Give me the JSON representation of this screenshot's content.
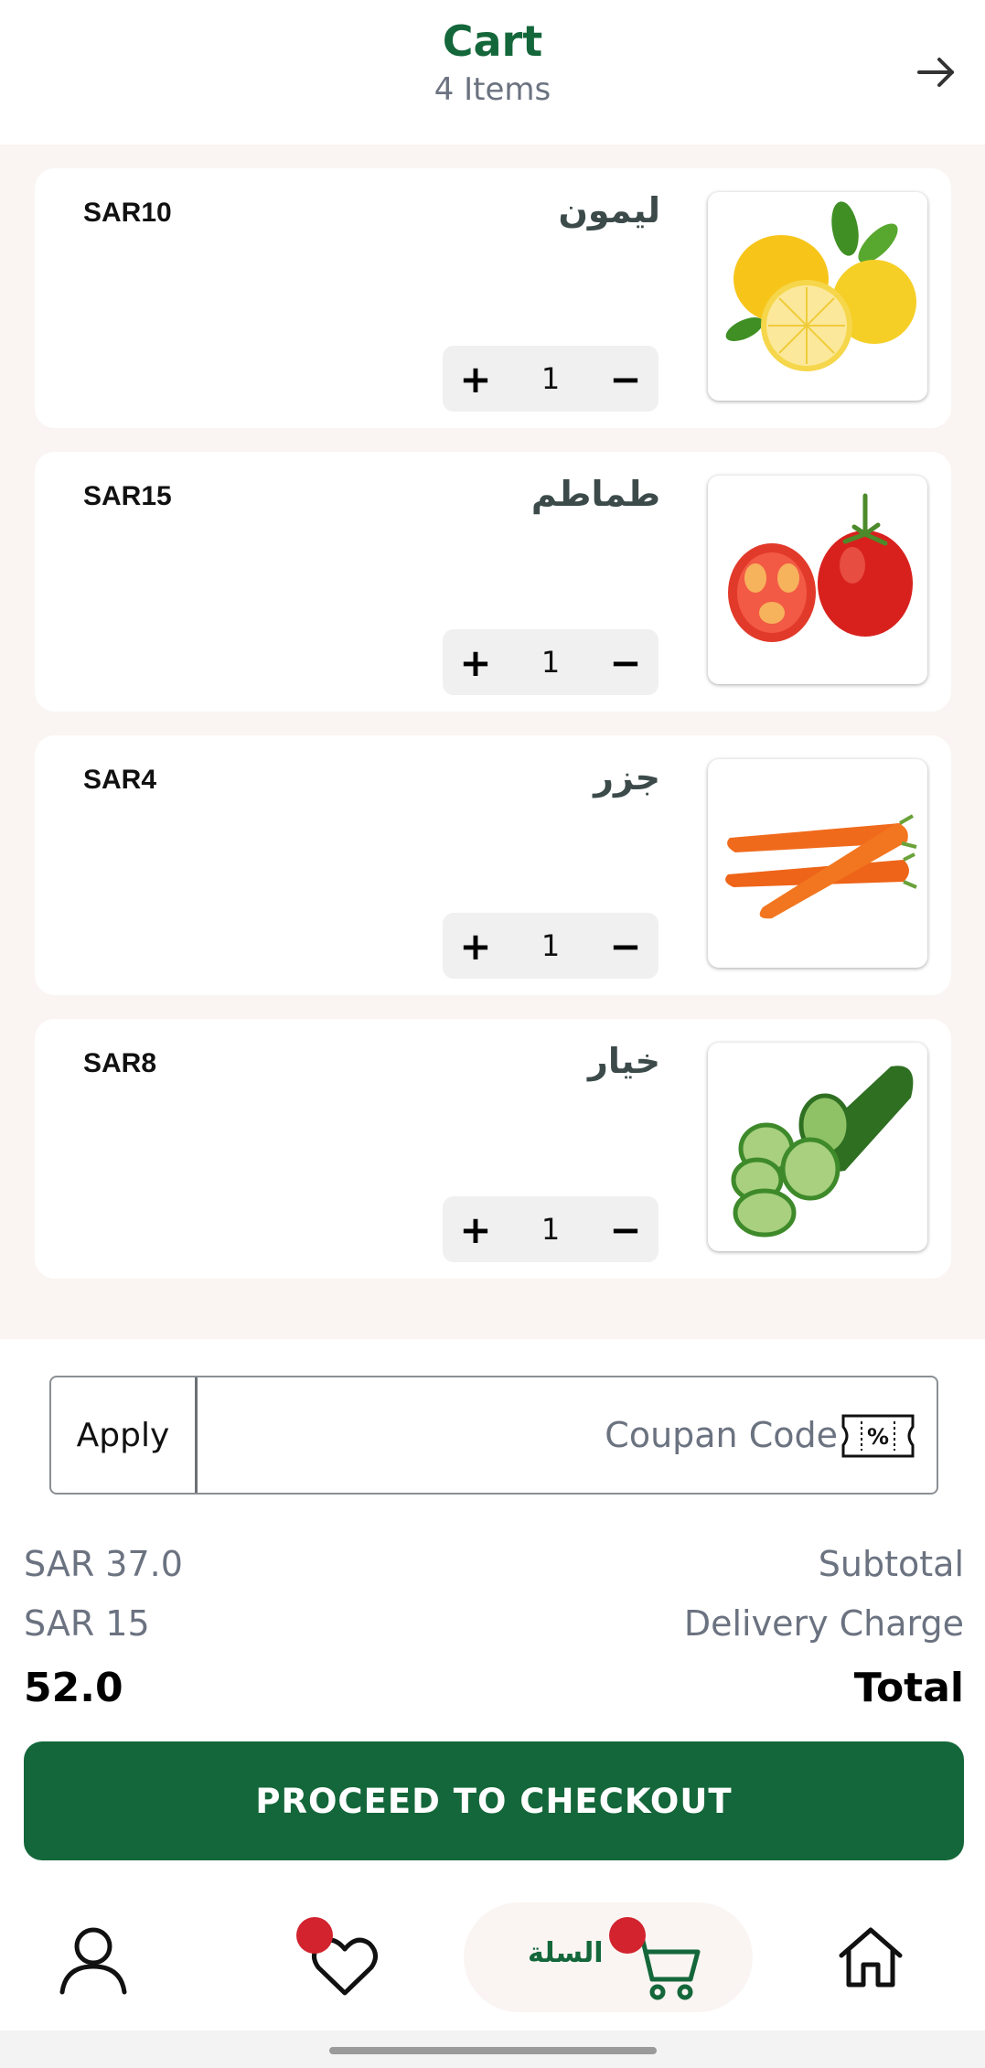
{
  "header": {
    "title": "Cart",
    "subtitle": "4 Items"
  },
  "items": [
    {
      "name": "ليمون",
      "price": "SAR10",
      "qty": "1",
      "plus": "+",
      "minus": "−",
      "image": "lemon-image"
    },
    {
      "name": "طماطم",
      "price": "SAR15",
      "qty": "1",
      "plus": "+",
      "minus": "−",
      "image": "tomato-image"
    },
    {
      "name": "جزر",
      "price": "SAR4",
      "qty": "1",
      "plus": "+",
      "minus": "−",
      "image": "carrot-image"
    },
    {
      "name": "خيار",
      "price": "SAR8",
      "qty": "1",
      "plus": "+",
      "minus": "−",
      "image": "cucumber-image"
    }
  ],
  "coupon": {
    "apply_label": "Apply",
    "placeholder": "Coupan Code",
    "value": ""
  },
  "summary": {
    "subtotal_label": "Subtotal",
    "subtotal_value": "SAR 37.0",
    "delivery_label": "Delivery Charge",
    "delivery_value": "SAR 15",
    "total_label": "Total",
    "total_value": "52.0"
  },
  "checkout_label": "PROCEED TO CHECKOUT",
  "nav": {
    "cart_label": "السلة"
  },
  "colors": {
    "brand": "#14673a",
    "badge": "#d2232e",
    "background": "#faf5f2"
  }
}
